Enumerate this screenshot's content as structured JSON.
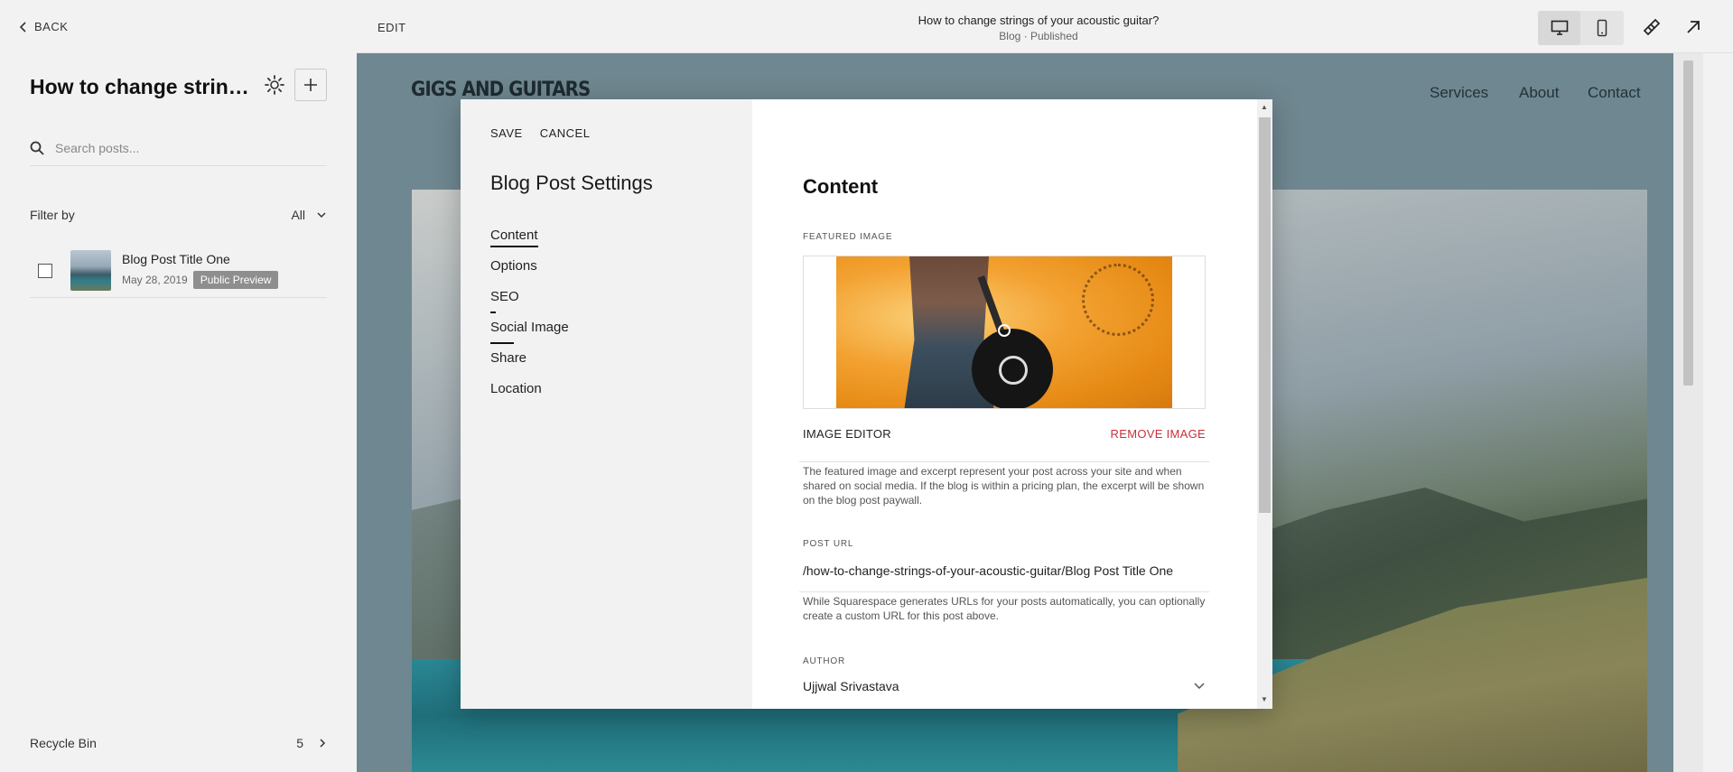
{
  "sidebar": {
    "back_label": "BACK",
    "title": "How to change strings of your acoustic guitar?",
    "search_placeholder": "Search posts...",
    "filter_label": "Filter by",
    "filter_value": "All",
    "posts": [
      {
        "title": "Blog Post Title One",
        "date": "May 28, 2019",
        "badge": "Public Preview"
      }
    ],
    "recycle_label": "Recycle Bin",
    "recycle_count": "5"
  },
  "topbar": {
    "edit_label": "EDIT",
    "page_title": "How to change strings of your acoustic guitar?",
    "page_status": "Blog · Published"
  },
  "site": {
    "logo": "GIGS AND GUITARS",
    "nav": [
      "Services",
      "About",
      "Contact"
    ]
  },
  "modal": {
    "save_label": "SAVE",
    "cancel_label": "CANCEL",
    "title": "Blog Post Settings",
    "nav": [
      "Content",
      "Options",
      "SEO",
      "Social Image",
      "Share",
      "Location"
    ],
    "content": {
      "heading": "Content",
      "featured_image_label": "FEATURED IMAGE",
      "image_editor_label": "IMAGE EDITOR",
      "remove_image_label": "REMOVE IMAGE",
      "featured_help": "The featured image and excerpt represent your post across your site and when shared on social media. If the blog is within a pricing plan, the excerpt will be shown on the blog post paywall.",
      "post_url_label": "POST URL",
      "post_url_value": "/how-to-change-strings-of-your-acoustic-guitar/Blog Post Title One",
      "post_url_help": "While Squarespace generates URLs for your posts automatically, you can optionally create a custom URL for this post above.",
      "author_label": "AUTHOR",
      "author_value": "Ujjwal Srivastava"
    }
  },
  "colors": {
    "accent_red": "#c9303a",
    "panel_bg": "#f2f2f2"
  }
}
